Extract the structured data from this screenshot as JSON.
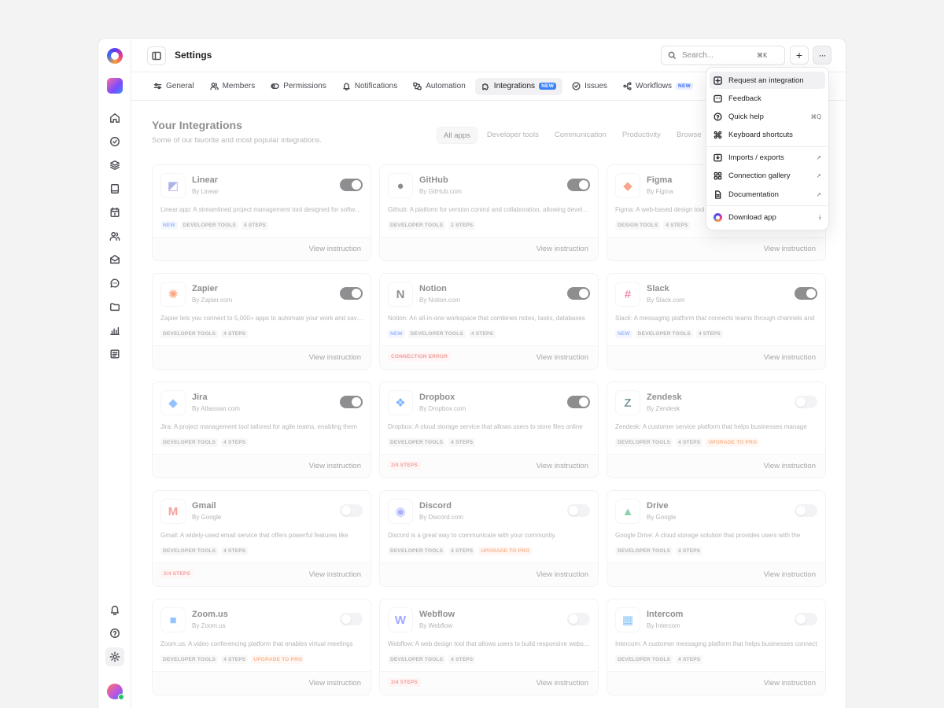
{
  "header": {
    "title": "Settings",
    "search_placeholder": "Search...",
    "search_shortcut": "⌘K"
  },
  "tabs": [
    {
      "label": "General",
      "icon": "sliders-icon"
    },
    {
      "label": "Members",
      "icon": "users-icon"
    },
    {
      "label": "Permissions",
      "icon": "toggle-icon"
    },
    {
      "label": "Notifications",
      "icon": "bell-icon"
    },
    {
      "label": "Automation",
      "icon": "automation-icon"
    },
    {
      "label": "Integrations",
      "icon": "puzzle-icon",
      "badge": "NEW",
      "active": true
    },
    {
      "label": "Issues",
      "icon": "check-circle-icon"
    },
    {
      "label": "Workflows",
      "icon": "workflow-icon",
      "badge": "NEW"
    }
  ],
  "section": {
    "title": "Your Integrations",
    "subtitle": "Some of our favorite and most popular integrations."
  },
  "filters": [
    "All apps",
    "Developer tools",
    "Communication",
    "Productivity",
    "Browse"
  ],
  "view_label": "View instruction",
  "integrations": [
    {
      "name": "Linear",
      "by": "By Linear",
      "desc": "Linear.app: A streamlined project management tool designed for software teams",
      "tags": [
        "NEW",
        "DEVELOPER TOOLS",
        "4 STEPS"
      ],
      "enabled": true,
      "color": "#5E6AD2"
    },
    {
      "name": "GitHub",
      "by": "By GitHub.com",
      "desc": "Github: A platform for version control and collaboration, allowing developers",
      "tags": [
        "DEVELOPER TOOLS",
        "2 STEPS"
      ],
      "enabled": true,
      "color": "#1f1f23"
    },
    {
      "name": "Figma",
      "by": "By Figma",
      "desc": "Figma: A web-based design tool",
      "tags": [
        "DESIGN TOOLS",
        "4 STEPS"
      ],
      "enabled": false,
      "color": "#F24E1E"
    },
    {
      "name": "Zapier",
      "by": "By Zapier.com",
      "desc": "Zapier lets you connect to 5,000+ apps to automate your work and save time",
      "tags": [
        "DEVELOPER TOOLS",
        "4 STEPS"
      ],
      "enabled": true,
      "color": "#FF4F00"
    },
    {
      "name": "Notion",
      "by": "By Notion.com",
      "desc": "Notion: An all-in-one workspace that combines notes, tasks, databases",
      "tags": [
        "NEW",
        "DEVELOPER TOOLS",
        "4 STEPS"
      ],
      "enabled": true,
      "status": "CONNECTION ERROR",
      "color": "#1f1f23"
    },
    {
      "name": "Slack",
      "by": "By Slack.com",
      "desc": "Slack: A messaging platform that connects teams through channels and",
      "tags": [
        "NEW",
        "DEVELOPER TOOLS",
        "4 STEPS"
      ],
      "enabled": true,
      "color": "#E01E5A"
    },
    {
      "name": "Jira",
      "by": "By Atlassian.com",
      "desc": "Jira: A project management tool tailored for agile teams, enabling them",
      "tags": [
        "DEVELOPER TOOLS",
        "4 STEPS"
      ],
      "enabled": true,
      "color": "#2684FF"
    },
    {
      "name": "Dropbox",
      "by": "By Dropbox.com",
      "desc": "Dropbox: A cloud storage service that allows users to store files online",
      "tags": [
        "DEVELOPER TOOLS",
        "4 STEPS"
      ],
      "enabled": true,
      "status": "2/4 STEPS",
      "color": "#0061FF"
    },
    {
      "name": "Zendesk",
      "by": "By Zendesk",
      "desc": "Zendesk: A customer service platform that helps businesses manage",
      "tags": [
        "DEVELOPER TOOLS",
        "4 STEPS",
        "UPGRADE TO PRO"
      ],
      "enabled": false,
      "color": "#03363D"
    },
    {
      "name": "Gmail",
      "by": "By Google",
      "desc": "Gmail: A widely-used email service that offers powerful features like",
      "tags": [
        "DEVELOPER TOOLS",
        "4 STEPS"
      ],
      "enabled": false,
      "status": "2/4 STEPS",
      "color": "#EA4335"
    },
    {
      "name": "Discord",
      "by": "By Discord.com",
      "desc": "Discord is a great way to communicate with your community.",
      "tags": [
        "DEVELOPER TOOLS",
        "4 STEPS",
        "UPGRADE TO PRO"
      ],
      "enabled": false,
      "color": "#5865F2"
    },
    {
      "name": "Drive",
      "by": "By Google",
      "desc": "Google Drive: A cloud storage solution that provides users with the",
      "tags": [
        "DEVELOPER TOOLS",
        "4 STEPS"
      ],
      "enabled": false,
      "color": "#1FA463"
    },
    {
      "name": "Zoom.us",
      "by": "By Zoom.us",
      "desc": "Zoom.us: A video conferencing platform that enables virtual meetings",
      "tags": [
        "DEVELOPER TOOLS",
        "4 STEPS",
        "UPGRADE TO PRO"
      ],
      "enabled": false,
      "color": "#2D8CFF"
    },
    {
      "name": "Webflow",
      "by": "By Webflow",
      "desc": "Webflow: A web design tool that allows users to build responsive websites",
      "tags": [
        "DEVELOPER TOOLS",
        "4 STEPS"
      ],
      "enabled": false,
      "status": "2/4 STEPS",
      "color": "#4353FF"
    },
    {
      "name": "Intercom",
      "by": "By Intercom",
      "desc": "Intercom: A customer messaging platform that helps businesses connect",
      "tags": [
        "DEVELOPER TOOLS",
        "4 STEPS"
      ],
      "enabled": false,
      "color": "#1F8DED"
    }
  ],
  "menu": {
    "items": [
      {
        "label": "Request an integration",
        "icon": "plus-square-icon"
      },
      {
        "label": "Feedback",
        "icon": "message-square-icon"
      },
      {
        "label": "Quick help",
        "icon": "help-circle-icon",
        "shortcut": "⌘Q"
      },
      {
        "label": "Keyboard shortcuts",
        "icon": "command-icon"
      },
      {
        "label": "Imports / exports",
        "icon": "import-icon",
        "trail": "↗"
      },
      {
        "label": "Connection gallery",
        "icon": "grid-icon",
        "trail": "↗"
      },
      {
        "label": "Documentation",
        "icon": "file-icon",
        "trail": "↗"
      },
      {
        "label": "Download app",
        "icon": "app-logo-icon",
        "trail": "⤓"
      }
    ]
  },
  "rail_icons": [
    "home-icon",
    "check-circle-icon",
    "layers-icon",
    "book-icon",
    "calendar-icon",
    "users-icon",
    "mail-icon",
    "chat-icon",
    "folder-icon",
    "chart-icon",
    "list-icon",
    "bell-icon",
    "help-icon",
    "settings-icon"
  ]
}
